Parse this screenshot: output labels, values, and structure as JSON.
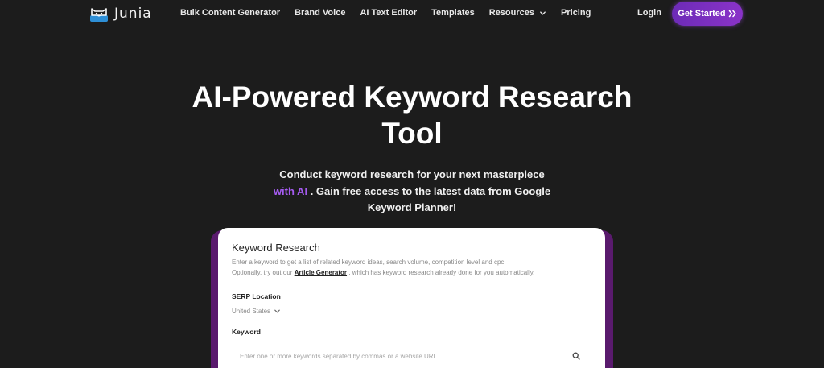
{
  "brand": {
    "name": "Junia",
    "logo_icon": "cat-face-logo-icon"
  },
  "nav": {
    "links": [
      {
        "label": "Bulk Content Generator"
      },
      {
        "label": "Brand Voice"
      },
      {
        "label": "AI Text Editor"
      },
      {
        "label": "Templates"
      },
      {
        "label": "Resources",
        "icon": "chevron-down-icon"
      },
      {
        "label": "Pricing"
      }
    ],
    "login": "Login",
    "cta": {
      "label": "Get Started",
      "arrows": "»",
      "color": "#7b2fc0"
    }
  },
  "hero": {
    "title_line1": "AI-Powered Keyword Research",
    "title_line2": "Tool",
    "sub_line1": "Conduct keyword research for your next masterpiece",
    "sub_highlight": "with AI",
    "sub_line2_rest": ". Gain free access to the latest data from Google",
    "sub_line3": "Keyword Planner!",
    "highlight_color": "#a55bf0"
  },
  "card": {
    "title": "Keyword Research",
    "desc_line1": "Enter a keyword to get a list of related keyword ideas, search volume, competition level and cpc.",
    "desc_line2_pre": "Optionally, try out our",
    "desc_link": "Article Generator",
    "desc_line2_post": ", which has keyword research already done for you automatically.",
    "serp_label": "SERP Location",
    "serp_value": "United States",
    "keyword_label": "Keyword",
    "keyword_placeholder": "Enter one or more keywords separated by commas or a website URL",
    "search_icon": "search-icon"
  }
}
